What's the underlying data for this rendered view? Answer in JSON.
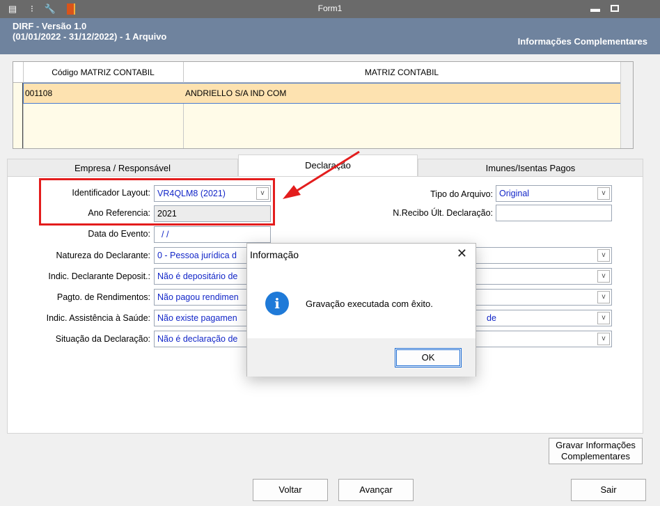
{
  "window": {
    "title": "Form1"
  },
  "header": {
    "app_line": "DIRF - Versão 1.0",
    "period_line": "(01/01/2022 - 31/12/2022) - 1 Arquivo",
    "section": "Informações Complementares"
  },
  "grid": {
    "columns": [
      "Código MATRIZ CONTABIL",
      "MATRIZ CONTABIL"
    ],
    "rows": [
      [
        "001108",
        "ANDRIELLO S/A IND COM"
      ]
    ]
  },
  "tabs": [
    {
      "label": "Empresa / Responsável"
    },
    {
      "label": "Declaração"
    },
    {
      "label": "Imunes/Isentas Pagos"
    }
  ],
  "form": {
    "identificador_layout": {
      "label": "Identificador Layout:",
      "value": "VR4QLM8 (2021)"
    },
    "ano_referencia": {
      "label": "Ano Referencia:",
      "value": "2021"
    },
    "data_evento": {
      "label": "Data do Evento:",
      "value": "/ /"
    },
    "natureza": {
      "label": "Natureza do Declarante:",
      "value": "0 - Pessoa jurídica d"
    },
    "indic_depositario": {
      "label": "Indic. Declarante Deposit.:",
      "value": "Não é depositário de"
    },
    "pagto_rendimentos": {
      "label": "Pagto. de Rendimentos:",
      "value": "Não pagou rendimen"
    },
    "indic_saude": {
      "label": "Indic. Assistência à Saúde:",
      "value": "Não existe pagamen",
      "right_value": "de"
    },
    "situacao": {
      "label": "Situação da Declaração:",
      "value": "Não é declaração de"
    },
    "tipo_arquivo": {
      "label": "Tipo do Arquivo:",
      "value": "Original"
    },
    "n_recibo": {
      "label": "N.Recibo Últ. Declaração:",
      "value": ""
    }
  },
  "dialog": {
    "title": "Informação",
    "message": "Gravação executada com êxito.",
    "ok_label": "OK"
  },
  "buttons": {
    "gravar_line1": "Gravar Informações",
    "gravar_line2": "Complementares",
    "voltar": "Voltar",
    "avancar": "Avançar",
    "sair": "Sair"
  },
  "colors": {
    "header_bg": "#6f839e",
    "titlebar_bg": "#6a6a6a",
    "selected_row": "#fde2b0",
    "field_text": "#1226c8",
    "highlight_red": "#e31d1d",
    "info_blue": "#1f7ad8"
  },
  "icons": [
    "calculator-icon",
    "traffic-light-icon",
    "wrench-icon",
    "book-icon",
    "minimize-icon",
    "restore-icon",
    "close-icon",
    "info-icon",
    "chevron-down-icon"
  ]
}
